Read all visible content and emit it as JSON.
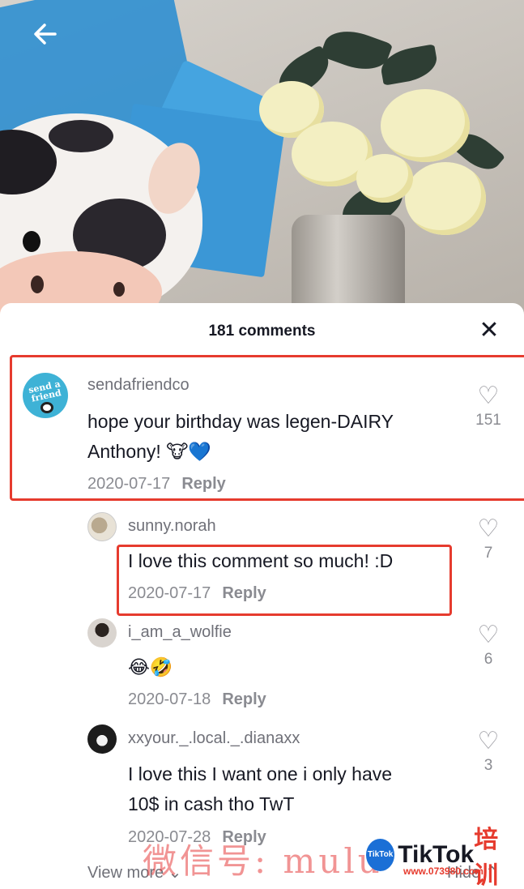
{
  "header": {
    "back_icon": "arrow-left-icon"
  },
  "sheet": {
    "title": "181 comments",
    "close_icon": "close-icon",
    "close_glyph": "✕"
  },
  "comments": [
    {
      "username": "sendafriendco",
      "avatar_text": "send a friend",
      "text_line1": "hope your birthday was legen-DAIRY",
      "text_line2": "Anthony! 🐮💙",
      "date": "2020-07-17",
      "reply": "Reply",
      "likes": "151"
    },
    {
      "username": "sunny.norah",
      "text_line1": "I love this comment so much! :D",
      "date": "2020-07-17",
      "reply": "Reply",
      "likes": "7"
    },
    {
      "username": "i_am_a_wolfie",
      "text_line1": "😂🤣",
      "date": "2020-07-18",
      "reply": "Reply",
      "likes": "6"
    },
    {
      "username": "xxyour._.local._.dianaxx",
      "text_line1": "I love this I want one i only have",
      "text_line2": "10$ in cash tho TwT",
      "date": "2020-07-28",
      "reply": "Reply",
      "likes": "3"
    }
  ],
  "footer": {
    "view_more": "View more ⌄",
    "hide": "Hide ⌃"
  },
  "watermark": {
    "cn_text": "微信号: mulu",
    "circle": "TikTok",
    "brand": "TikTok",
    "brand_cn": "培训",
    "url": "www.073980.com"
  },
  "colors": {
    "highlight": "#e63b2e",
    "text_primary": "#161823",
    "text_secondary": "#8a8b91"
  },
  "icons": {
    "like": "heart-outline-icon"
  }
}
